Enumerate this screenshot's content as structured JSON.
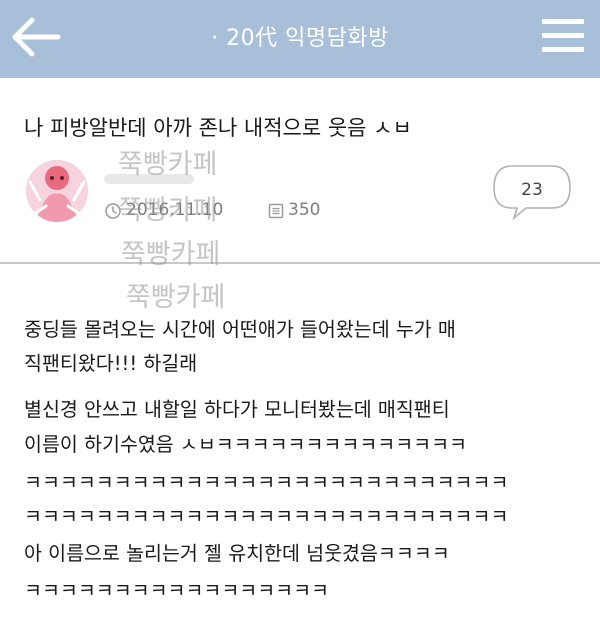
{
  "header": {
    "title": "· 20代 익명담화방",
    "bg_color": "#a8bfda",
    "back_icon": "arrow-left-icon",
    "menu_icon": "hamburger-menu-icon"
  },
  "post": {
    "title": "나 피방알반데 아까 존나 내적으로 웃음 ㅅㅂ",
    "date": "2016.11.10",
    "views": "350",
    "comment_count": "23",
    "body_lines": [
      "중딩들 몰려오는 시간에 어떤애가 들어왔는데 누가 매",
      "직팬티왔다!!! 하길래",
      "별신경 안쓰고 내할일 하다가 모니터봤는데 매직팬티",
      "이름이 하기수였음 ㅅㅂㅋㅋㅋㅋㅋㅋㅋㅋㅋㅋㅋㅋㅋㅋ",
      "ㅋㅋㅋㅋㅋㅋㅋㅋㅋㅋㅋㅋㅋㅋㅋㅋㅋㅋㅋㅋㅋㅋㅋㅋㅋㅋㅋ",
      "ㅋㅋㅋㅋㅋㅋㅋㅋㅋㅋㅋㅋㅋㅋㅋㅋㅋㅋㅋㅋㅋㅋㅋㅋㅋㅋㅋ",
      "아 이름으로 놀리는거 젤 유치한데 넘웃겼음ㅋㅋㅋㅋ",
      "ㅋㅋㅋㅋㅋㅋㅋㅋㅋㅋㅋㅋㅋㅋㅋㅋㅋ"
    ]
  },
  "watermark": {
    "text": "쭉빵카페"
  }
}
